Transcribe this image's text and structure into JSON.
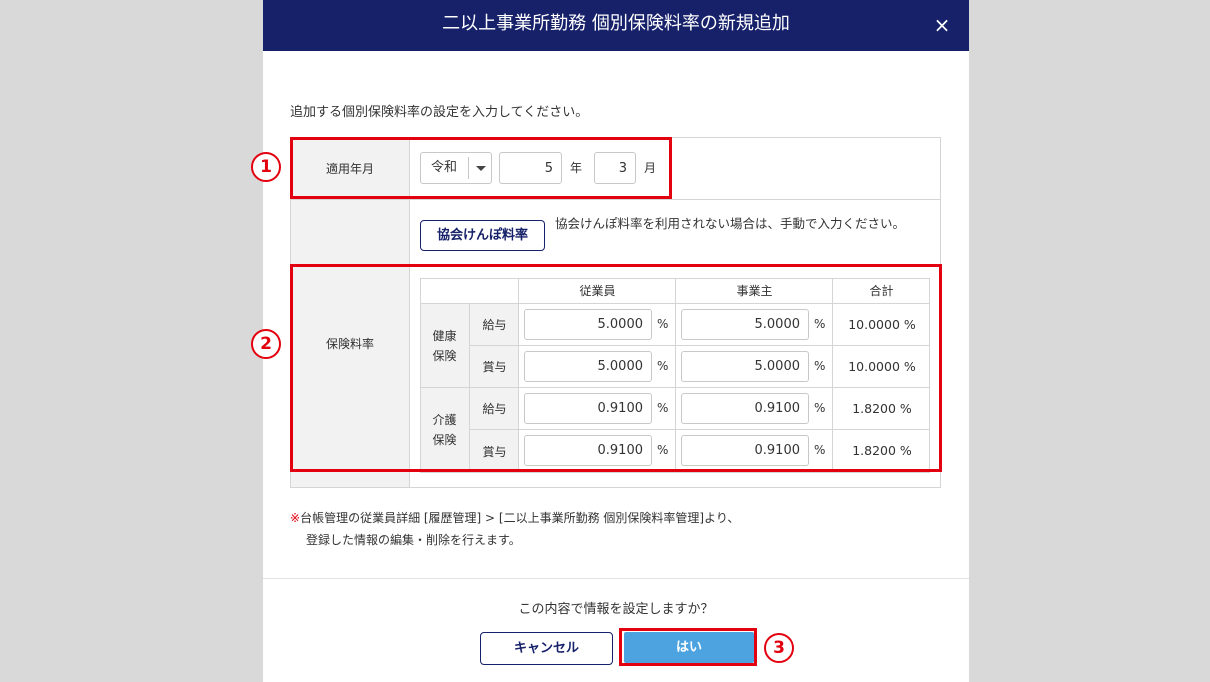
{
  "modal": {
    "title": "二以上事業所勤務 個別保険料率の新規追加",
    "close_icon": "×",
    "intro": "追加する個別保険料率の設定を入力してください。"
  },
  "period": {
    "label": "適用年月",
    "era": "令和",
    "year": "5",
    "year_unit": "年",
    "month": "3",
    "month_unit": "月"
  },
  "rates": {
    "label": "保険料率",
    "kyokai_button": "協会けんぽ料率",
    "kyokai_note": "協会けんぽ料率を利用されない場合は、手動で入力ください。",
    "headers": {
      "employee": "従業員",
      "employer": "事業主",
      "total": "合計"
    },
    "percent_unit": "%",
    "groups": [
      {
        "name_line1": "健康",
        "name_line2": "保険",
        "rows": [
          {
            "type": "給与",
            "employee": "5.0000",
            "employer": "5.0000",
            "total": "10.0000 %"
          },
          {
            "type": "賞与",
            "employee": "5.0000",
            "employer": "5.0000",
            "total": "10.0000 %"
          }
        ]
      },
      {
        "name_line1": "介護",
        "name_line2": "保険",
        "rows": [
          {
            "type": "給与",
            "employee": "0.9100",
            "employer": "0.9100",
            "total": "1.8200 %"
          },
          {
            "type": "賞与",
            "employee": "0.9100",
            "employer": "0.9100",
            "total": "1.8200 %"
          }
        ]
      }
    ]
  },
  "footnote": {
    "mark": "※",
    "line1": "台帳管理の従業員詳細 [履歴管理] > [二以上事業所勤務 個別保険料率管理]より、",
    "line2": "登録した情報の編集・削除を行えます。"
  },
  "footer": {
    "confirm": "この内容で情報を設定しますか？",
    "cancel": "キャンセル",
    "yes": "はい"
  },
  "annotations": [
    "1",
    "2",
    "3"
  ],
  "colors": {
    "header": "#16216a",
    "primary": "#4da3e0",
    "highlight": "#e3000f",
    "backdrop": "#d9d9d9"
  }
}
